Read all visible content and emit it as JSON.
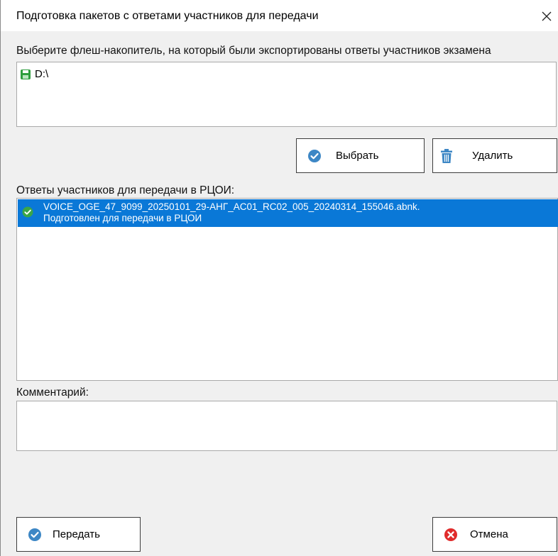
{
  "window": {
    "title": "Подготовка пакетов с ответами участников для передачи",
    "close_symbol": "✕"
  },
  "drive_section": {
    "label": "Выберите флеш-накопитель, на который были экспортированы ответы участников экзамена",
    "drives": [
      {
        "name": "D:\\",
        "icon": "green-floppy-disk-icon"
      }
    ]
  },
  "buttons": {
    "select_label": "Выбрать",
    "delete_label": "Удалить",
    "send_label": "Передать",
    "cancel_label": "Отмена"
  },
  "answers_section": {
    "label": "Ответы участников для передачи в РЦОИ:",
    "items": [
      {
        "filename": "VOICE_OGE_47_9099_20250101_29-АНГ_AC01_RC02_005_20240314_155046.abnk.",
        "status": "Подготовлен для передачи в РЦОИ",
        "selected": true
      }
    ]
  },
  "comment_section": {
    "label": "Комментарий:",
    "value": ""
  },
  "colors": {
    "accent_blue": "#3d87c5",
    "selection_blue": "#0a78d7",
    "ok_green": "#3aa648",
    "cancel_red": "#e02b2b"
  }
}
